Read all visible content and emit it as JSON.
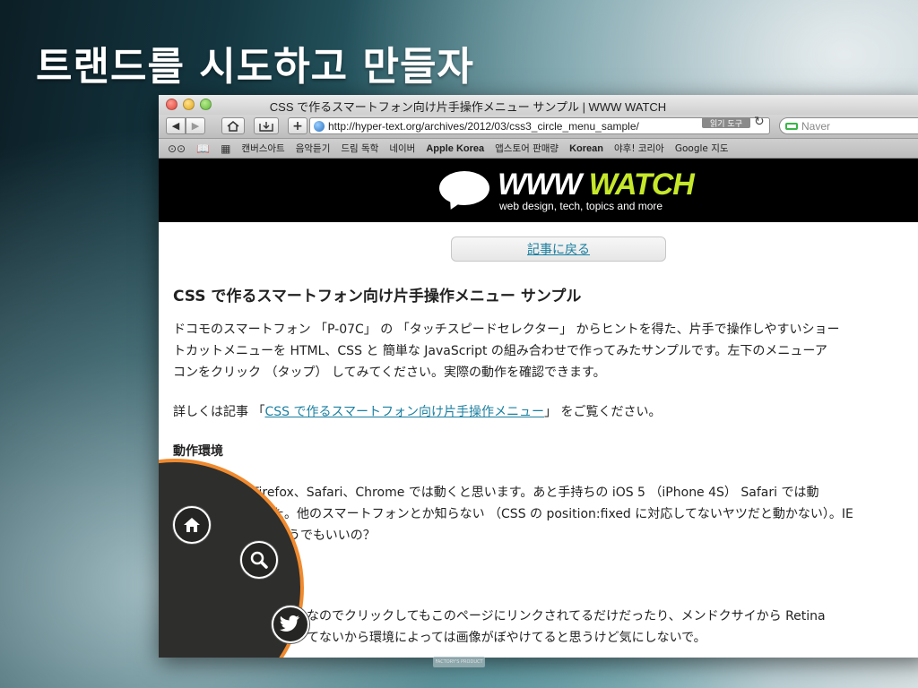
{
  "slide": {
    "title": "트랜드를 시도하고 만들자"
  },
  "window": {
    "title": "CSS で作るスマートフォン向け片手操作メニュー サンプル | WWW WATCH"
  },
  "toolbar": {
    "url": "http://hyper-text.org/archives/2012/03/css3_circle_menu_sample/",
    "reader_label": "읽기 도구",
    "search_placeholder": "Naver"
  },
  "bookmarks": [
    "캔버스아트",
    "음악듣기",
    "드림 독학",
    "네이버",
    "Apple Korea",
    "앱스토어 판매량",
    "Korean",
    "야후! 코리아",
    "Google 지도"
  ],
  "site": {
    "logo_www": "WWW",
    "logo_watch": "WATCH",
    "tagline": "web design, tech, topics and more"
  },
  "page": {
    "back_label": "記事に戻る",
    "title": "CSS で作るスマートフォン向け片手操作メニュー サンプル",
    "intro_lines": [
      "ドコモのスマートフォン 「P-07C」 の 「タッチスピードセレクター」 からヒントを得た、片手で操作しやすいショー",
      "トカットメニューを HTML、CSS と 簡単な JavaScript の組み合わせで作ってみたサンプルです。左下のメニューア",
      "コンをクリック （タップ） してみてください。実際の動作を確認できます。"
    ],
    "detail_prefix": "詳しくは記事 「",
    "detail_link": "CSS で作るスマートフォン向け片手操作メニュー",
    "detail_suffix": "」 をご覧ください。",
    "env_heading": "動作環境",
    "env_lines": [
      "現在最新版の Firefox、Safari、Chrome では動くと思います。あと手持ちの iOS 5 （iPhone 4S） Safari では動",
      "確認しました。他のスマートフォンとか知らない （CSS の position:fixed に対応してないヤツだと動かない）。IE",
      "はどうでもいいの？"
    ],
    "note_lines": [
      "なのでクリックしてもこのページにリンクされてるだけだったり、メンドクサイから Retina",
      "てないから環境によっては画像がぼやけてると思うけど気にしないで。"
    ]
  },
  "menu": {
    "items": [
      "home-icon",
      "search-icon",
      "twitter-icon"
    ],
    "accent": "#f08a2e"
  },
  "footer": {
    "badge": "FACTORY'S PRODUCT"
  }
}
